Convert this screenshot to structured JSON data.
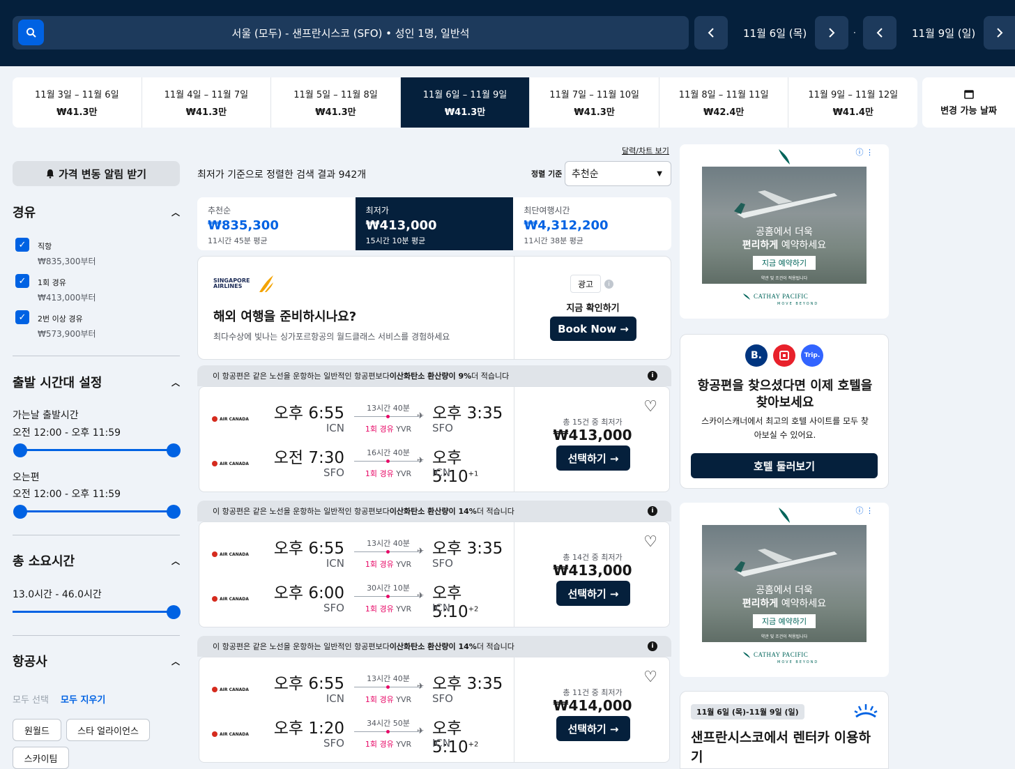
{
  "search": {
    "route": "서울 (모두) - 샌프란시스코 (SFO)  •  성인 1명, 일반석",
    "depart_date": "11월 6일 (목)",
    "return_date": "11월 9일 (일)",
    "separator": "·"
  },
  "date_options": [
    {
      "range": "11월 3일 – 11월 6일",
      "price": "₩41.3만"
    },
    {
      "range": "11월 4일 – 11월 7일",
      "price": "₩41.3만"
    },
    {
      "range": "11월 5일 – 11월 8일",
      "price": "₩41.3만"
    },
    {
      "range": "11월 6일 – 11월 9일",
      "price": "₩41.3만"
    },
    {
      "range": "11월 7일 – 11월 10일",
      "price": "₩41.3만"
    },
    {
      "range": "11월 8일 – 11월 11일",
      "price": "₩42.4만"
    },
    {
      "range": "11월 9일 – 11월 12일",
      "price": "₩41.4만"
    }
  ],
  "flexible_dates": "변경 가능 날짜",
  "sidebar": {
    "alert_button": "가격 변동 알림 받기",
    "stops": {
      "title": "경유",
      "options": [
        {
          "label": "직항",
          "price": "₩835,300부터"
        },
        {
          "label": "1회 경유",
          "price": "₩413,000부터"
        },
        {
          "label": "2번 이상 경유",
          "price": "₩573,900부터"
        }
      ]
    },
    "departure": {
      "title": "출발 시간대 설정",
      "outbound_label": "가는날 출발시간",
      "outbound_range": "오전 12:00 - 오후 11:59",
      "return_label": "오는편",
      "return_range": "오전 12:00 - 오후 11:59"
    },
    "duration": {
      "title": "총 소요시간",
      "range": "13.0시간 - 46.0시간"
    },
    "airlines": {
      "title": "항공사",
      "select_all": "모두 선택",
      "clear_all": "모두 지우기",
      "chips": [
        "원월드",
        "스타 얼라이언스",
        "스카이팀"
      ]
    }
  },
  "results": {
    "count_text": "최저가 기준으로 정렬한 검색 결과 942개",
    "chart_link": "달력/차트 보기",
    "sort_label": "정렬 기준",
    "sort_value": "추천순",
    "tabs": [
      {
        "title": "추천순",
        "price": "₩835,300",
        "sub": "11시간 45분 평균"
      },
      {
        "title": "최저가",
        "price": "₩413,000",
        "sub": "15시간 10분 평균"
      },
      {
        "title": "최단여행시간",
        "price": "₩4,312,200",
        "sub": "11시간 38분 평균"
      }
    ]
  },
  "sponsored": {
    "logo": "SINGAPORE AIRLINES",
    "headline": "해외 여행을 준비하시나요?",
    "body": "최다수상에 빛나는 싱가포르항공의 월드클래스 서비스를 경험하세요",
    "ad_label": "광고",
    "cta_label": "지금 확인하기",
    "cta_button": "Book Now →"
  },
  "flights": [
    {
      "co2_pre": "이 항공편은 같은 노선을 운항하는 일반적인 항공편보다 ",
      "co2_bold": "이산화탄소 환산량이 9%",
      "co2_post": " 더 적습니다",
      "legs": [
        {
          "airline": "AIR CANADA",
          "dep": "오후 6:55",
          "dep_ap": "ICN",
          "dur": "13시간 40분",
          "stops": "1회 경유",
          "via": "YVR",
          "arr": "오후 3:35",
          "plus": "",
          "arr_ap": "SFO"
        },
        {
          "airline": "AIR CANADA",
          "dep": "오전 7:30",
          "dep_ap": "SFO",
          "dur": "16시간 40분",
          "stops": "1회 경유",
          "via": "YVR",
          "arr": "오후 5:10",
          "plus": "+1",
          "arr_ap": "ICN"
        }
      ],
      "deals": "총 15건 중 최저가",
      "price": "₩413,000",
      "select": "선택하기 →"
    },
    {
      "co2_pre": "이 항공편은 같은 노선을 운항하는 일반적인 항공편보다 ",
      "co2_bold": "이산화탄소 환산량이 14%",
      "co2_post": " 더 적습니다",
      "legs": [
        {
          "airline": "AIR CANADA",
          "dep": "오후 6:55",
          "dep_ap": "ICN",
          "dur": "13시간 40분",
          "stops": "1회 경유",
          "via": "YVR",
          "arr": "오후 3:35",
          "plus": "",
          "arr_ap": "SFO"
        },
        {
          "airline": "AIR CANADA",
          "dep": "오후 6:00",
          "dep_ap": "SFO",
          "dur": "30시간 10분",
          "stops": "1회 경유",
          "via": "YVR",
          "arr": "오후 5:10",
          "plus": "+2",
          "arr_ap": "ICN"
        }
      ],
      "deals": "총 14건 중 최저가",
      "price": "₩413,000",
      "select": "선택하기 →"
    },
    {
      "co2_pre": "이 항공편은 같은 노선을 운항하는 일반적인 항공편보다 ",
      "co2_bold": "이산화탄소 환산량이 14%",
      "co2_post": " 더 적습니다",
      "legs": [
        {
          "airline": "AIR CANADA",
          "dep": "오후 6:55",
          "dep_ap": "ICN",
          "dur": "13시간 40분",
          "stops": "1회 경유",
          "via": "YVR",
          "arr": "오후 3:35",
          "plus": "",
          "arr_ap": "SFO"
        },
        {
          "airline": "AIR CANADA",
          "dep": "오후 1:20",
          "dep_ap": "SFO",
          "dur": "34시간 50분",
          "stops": "1회 경유",
          "via": "YVR",
          "arr": "오후 5:10",
          "plus": "+2",
          "arr_ap": "ICN"
        }
      ],
      "deals": "총 11건 중 최저가",
      "price": "₩414,000",
      "select": "선택하기 →"
    }
  ],
  "ads": {
    "cathay": {
      "line1": "공홈에서 더욱",
      "line2_bold": "편리하게",
      "line2_rest": " 예약하세요",
      "cta": "지금 예약하기",
      "terms": "약관 및 조건이 적용됩니다",
      "brand": "CATHAY PACIFIC",
      "tagline": "MOVE BEYOND"
    },
    "hotel": {
      "title": "항공편을 찾으셨다면 이제 호텔을 찾아보세요",
      "body": "스카이스캐너에서 최고의 호텔 사이트를 모두 찾아보실 수 있어요.",
      "button": "호텔 둘러보기",
      "logos": [
        "B.",
        "",
        "Trip."
      ]
    },
    "car": {
      "dates": "11월 6일 (목)-11월 9일 (일)",
      "title": "샌프란시스코에서 렌터카 이용하기"
    }
  },
  "colors": {
    "navy": "#05203c",
    "blue": "#0062e3",
    "pink": "#e70866"
  }
}
